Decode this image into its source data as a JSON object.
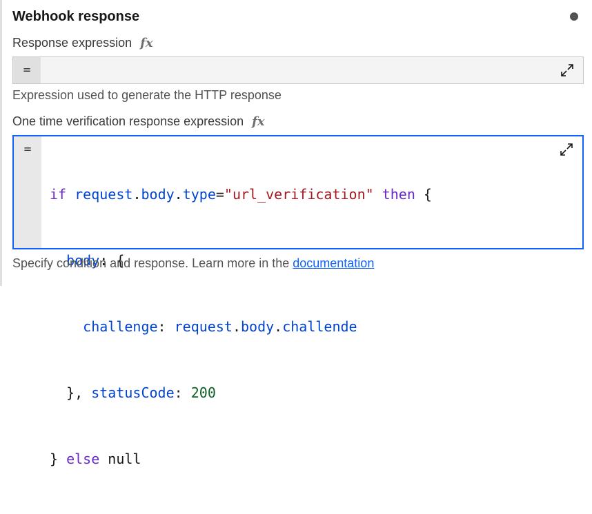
{
  "section": {
    "title": "Webhook response"
  },
  "response_expression": {
    "label": "Response expression",
    "fx": "fx",
    "prefix": "=",
    "value": "",
    "helper": "Expression used to generate the HTTP response"
  },
  "verification_expression": {
    "label": "One time verification response expression",
    "fx": "fx",
    "prefix": "=",
    "code_lines": [
      "if request.body.type=\"url_verification\" then {",
      "  body: {",
      "    challenge: request.body.challende",
      "  }, statusCode: 200",
      "} else null"
    ],
    "helper_text": "Specify condition and response. Learn more in the ",
    "helper_link": "documentation"
  },
  "colors": {
    "accent": "#0f62fe",
    "keyword": "#6929c4",
    "string": "#a2191f",
    "property": "#0043ce",
    "number": "#0e6027"
  },
  "icons": [
    "status-dot",
    "fx-icon",
    "expand-icon"
  ]
}
